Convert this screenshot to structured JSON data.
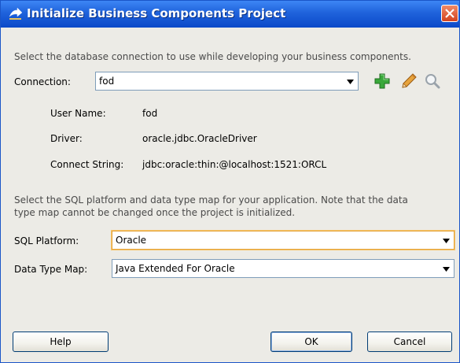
{
  "window": {
    "title": "Initialize Business Components Project"
  },
  "intro_text": "Select the database connection to use while developing your business components.",
  "connection": {
    "label": "Connection:",
    "value": "fod"
  },
  "details": {
    "user_name_label": "User Name:",
    "user_name_value": "fod",
    "driver_label": "Driver:",
    "driver_value": "oracle.jdbc.OracleDriver",
    "connect_string_label": "Connect String:",
    "connect_string_value": "jdbc:oracle:thin:@localhost:1521:ORCL"
  },
  "platform_text_line1": "Select the SQL platform and data type map for your application.  Note that the data",
  "platform_text_line2": "type map cannot be changed once the project is initialized.",
  "sql_platform": {
    "label": "SQL Platform:",
    "value": "Oracle"
  },
  "data_type_map": {
    "label": "Data Type Map:",
    "value": "Java Extended For Oracle"
  },
  "buttons": {
    "help": "Help",
    "ok": "OK",
    "cancel": "Cancel"
  },
  "icons": {
    "title": "arrow-app-icon",
    "add": "plus-icon",
    "edit": "pencil-icon",
    "browse": "magnifier-icon"
  }
}
